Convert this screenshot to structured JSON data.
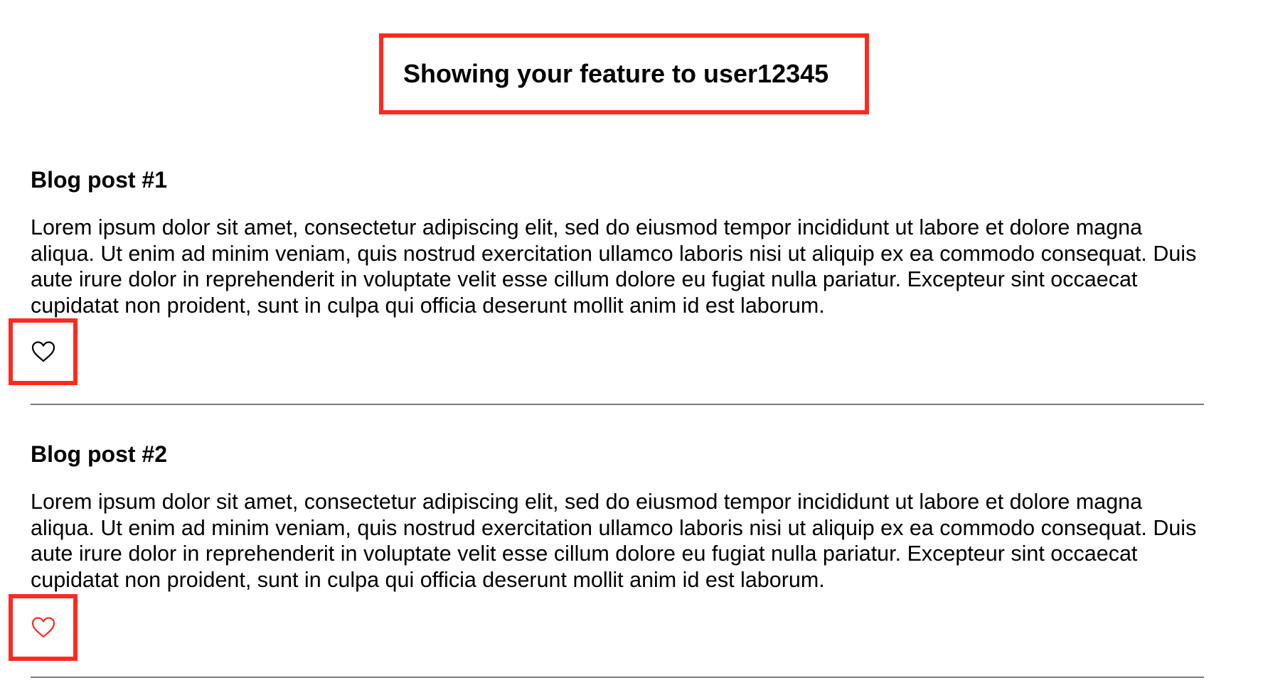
{
  "banner": {
    "text": "Showing your feature to user12345",
    "highlight_color": "#ff2a1f"
  },
  "posts": [
    {
      "title": "Blog post #1",
      "body": "Lorem ipsum dolor sit amet, consectetur adipiscing elit, sed do eiusmod tempor incididunt ut labore et dolore magna aliqua. Ut enim ad minim veniam, quis nostrud exercitation ullamco laboris nisi ut aliquip ex ea commodo consequat. Duis aute irure dolor in reprehenderit in voluptate velit esse cillum dolore eu fugiat nulla pariatur. Excepteur sint occaecat cupidatat non proident, sunt in culpa qui officia deserunt mollit anim id est laborum.",
      "like_icon": "heart-outline-icon",
      "like_color": "#000000"
    },
    {
      "title": "Blog post #2",
      "body": "Lorem ipsum dolor sit amet, consectetur adipiscing elit, sed do eiusmod tempor incididunt ut labore et dolore magna aliqua. Ut enim ad minim veniam, quis nostrud exercitation ullamco laboris nisi ut aliquip ex ea commodo consequat. Duis aute irure dolor in reprehenderit in voluptate velit esse cillum dolore eu fugiat nulla pariatur. Excepteur sint occaecat cupidatat non proident, sunt in culpa qui officia deserunt mollit anim id est laborum.",
      "like_icon": "heart-outline-icon",
      "like_color": "#ff2a1f"
    }
  ]
}
